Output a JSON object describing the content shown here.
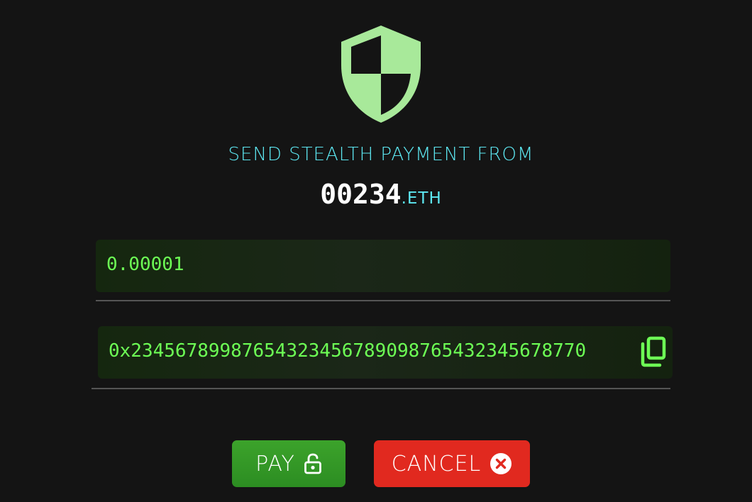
{
  "header": {
    "title": "SEND STEALTH PAYMENT FROM",
    "ens_name": "00234",
    "ens_suffix": ".ETH"
  },
  "form": {
    "amount_value": "0.00001",
    "address_value": "0x23456789987654323456789098765432345678770"
  },
  "actions": {
    "pay_label": "PAY",
    "cancel_label": "CANCEL"
  },
  "icons": {
    "shield": "shield-icon",
    "copy": "copy-icon",
    "unlock": "unlock-icon",
    "cancel": "close-circle-icon"
  },
  "colors": {
    "background": "#141414",
    "accent_cyan": "#5de8f2",
    "field_text_green": "#6dff55",
    "shield_green": "#a8e99a",
    "pay_green": "#34982a",
    "cancel_red": "#e1291f"
  }
}
